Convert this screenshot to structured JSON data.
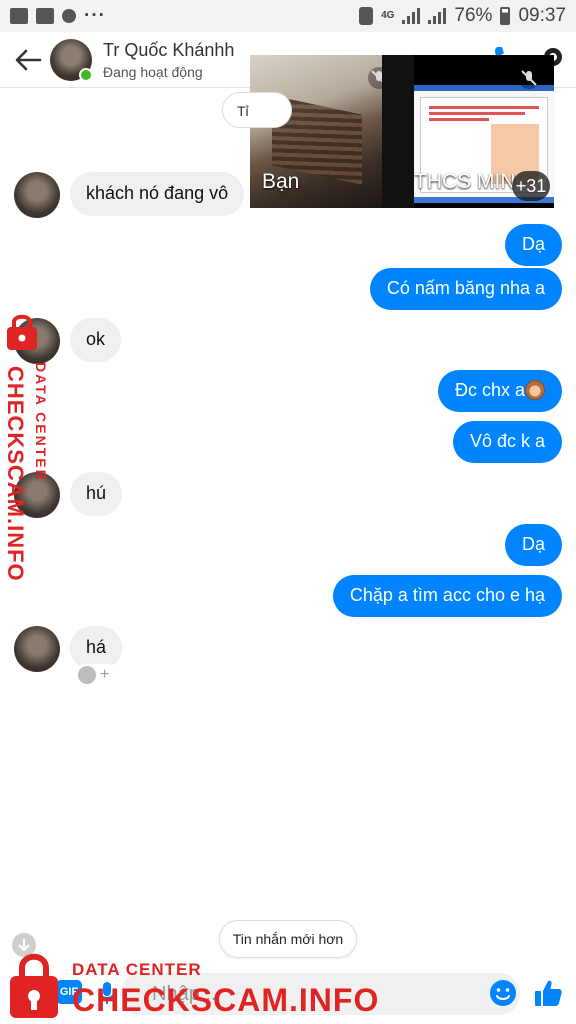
{
  "status_bar": {
    "network": "4G",
    "battery": "76%",
    "time": "09:37"
  },
  "header": {
    "contact_name": "Tr Quốc Khánhh",
    "status": "Đang hoạt động"
  },
  "call": {
    "self_label": "Bạn",
    "remote_label": "THCS MIN",
    "more_count": "+31"
  },
  "chat": {
    "date_pill": "Tỉ",
    "messages": [
      {
        "dir": "in",
        "text": "khách nó đang vô"
      },
      {
        "dir": "out",
        "text": "Dạ"
      },
      {
        "dir": "out",
        "text": "Có nấm băng nha a"
      },
      {
        "dir": "in",
        "text": "ok"
      },
      {
        "dir": "out",
        "text": "Đc chx a",
        "emoji": "woman-emoji"
      },
      {
        "dir": "out",
        "text": "Vô đc k a"
      },
      {
        "dir": "in",
        "text": "hú"
      },
      {
        "dir": "out",
        "text": "Dạ"
      },
      {
        "dir": "out",
        "text": "Chặp a tìm acc cho e hạ"
      },
      {
        "dir": "in",
        "text": "há"
      }
    ],
    "react_plus": "+"
  },
  "new_messages_label": "Tin nhắn mới hơn",
  "composer": {
    "gif_label": "GIF",
    "placeholder": "Nhập..."
  },
  "watermark": {
    "brand": "CHECKSCAM.INFO",
    "sub": "DATA CENTER",
    "color": "#e02323"
  },
  "colors": {
    "accent": "#0084ff",
    "online": "#42b72a",
    "incoming_bubble": "#f1f0f0"
  }
}
